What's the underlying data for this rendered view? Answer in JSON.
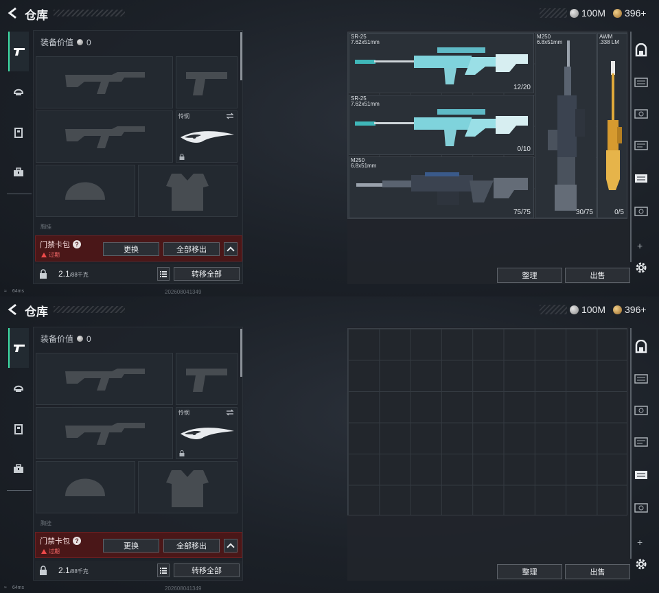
{
  "screens": [
    {
      "title": "仓库",
      "currency": {
        "silver": "100M",
        "gold": "396+"
      },
      "loadout": {
        "value_label": "装备价值",
        "value": "0",
        "knife_label": "怜悯",
        "truncated_label": "胸挂",
        "keycard": {
          "title": "门禁卡包",
          "status": "过期",
          "replace": "更换",
          "remove_all": "全部移出"
        },
        "weight": "2.1",
        "weight_unit": "/88千克",
        "transfer_all": "转移全部"
      },
      "storage": {
        "items": [
          {
            "name": "SR-25",
            "caliber": "7.62x51mm",
            "count": "12/20"
          },
          {
            "name": "SR-25",
            "caliber": "7.62x51mm",
            "count": "0/10"
          },
          {
            "name": "M250",
            "caliber": "6.8x51mm",
            "count": "75/75"
          },
          {
            "name": "M250",
            "caliber": "6.8x51mm",
            "count": "30/75"
          },
          {
            "name": "AWM",
            "caliber": ".338 LM",
            "count": "0/5"
          }
        ],
        "sort": "整理",
        "sell": "出售"
      },
      "status": {
        "ping": "64ms",
        "timestamp": "202608041349"
      }
    },
    {
      "title": "仓库",
      "currency": {
        "silver": "100M",
        "gold": "396+"
      },
      "loadout": {
        "value_label": "装备价值",
        "value": "0",
        "knife_label": "怜悯",
        "truncated_label": "胸挂",
        "keycard": {
          "title": "门禁卡包",
          "status": "过期",
          "replace": "更换",
          "remove_all": "全部移出"
        },
        "weight": "2.1",
        "weight_unit": "/88千克",
        "transfer_all": "转移全部"
      },
      "storage": {
        "items": [],
        "sort": "整理",
        "sell": "出售"
      },
      "status": {
        "ping": "64ms",
        "timestamp": "202608041349"
      }
    }
  ],
  "icons": [
    "back-icon",
    "pistol-icon",
    "helmet-icon",
    "vest-icon",
    "toolbox-icon",
    "lock-icon",
    "list-icon",
    "swap-icon",
    "gear-icon",
    "plus-icon",
    "storage-case-icon"
  ],
  "colors": {
    "accent": "#3fe0a8",
    "danger": "#f04a4a",
    "keycard_bg": "#4a1718"
  }
}
